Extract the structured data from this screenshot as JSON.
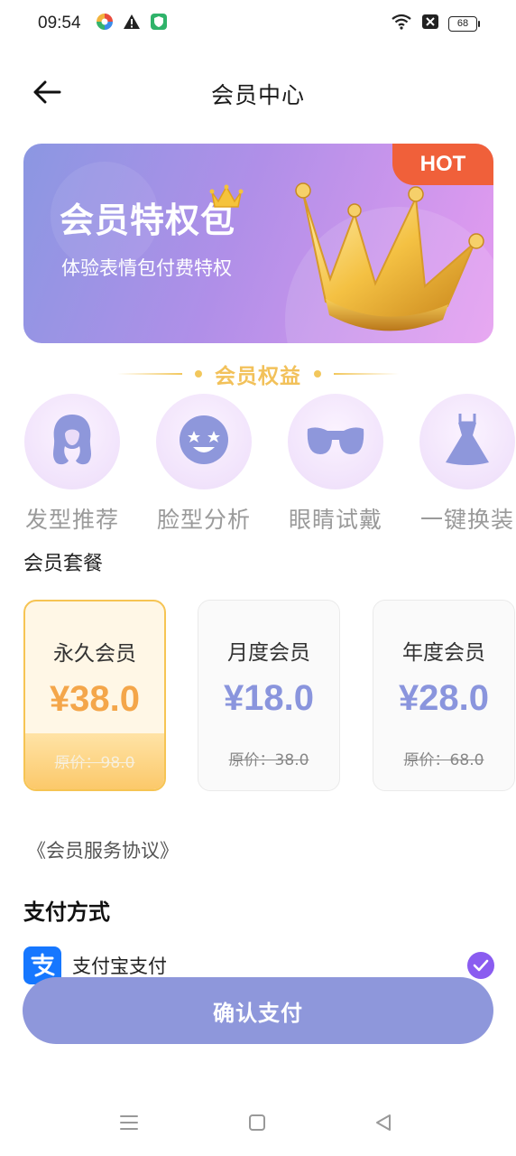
{
  "status_bar": {
    "time": "09:54",
    "battery": "68"
  },
  "header": {
    "title": "会员中心"
  },
  "banner": {
    "title": "会员特权包",
    "subtitle": "体验表情包付费特权",
    "badge": "HOT"
  },
  "benefits": {
    "title": "会员权益",
    "items": [
      {
        "label": "发型推荐",
        "icon": "hair-icon"
      },
      {
        "label": "脸型分析",
        "icon": "face-icon"
      },
      {
        "label": "眼睛试戴",
        "icon": "glasses-icon"
      },
      {
        "label": "一键换装",
        "icon": "dress-icon"
      }
    ]
  },
  "plans": {
    "title": "会员套餐",
    "items": [
      {
        "name": "永久会员",
        "price": "¥38.0",
        "original": "原价：98.0",
        "selected": true
      },
      {
        "name": "月度会员",
        "price": "¥18.0",
        "original": "原价：38.0",
        "selected": false
      },
      {
        "name": "年度会员",
        "price": "¥28.0",
        "original": "原价：68.0",
        "selected": false
      }
    ]
  },
  "agreement": "《会员服务协议》",
  "payment": {
    "title": "支付方式",
    "method": "支付宝支付",
    "method_icon": "alipay-icon"
  },
  "confirm_button": "确认支付",
  "colors": {
    "accent": "#8e97db",
    "gold": "#f2c15a",
    "hot": "#f0603a",
    "check": "#8a5cf0"
  }
}
